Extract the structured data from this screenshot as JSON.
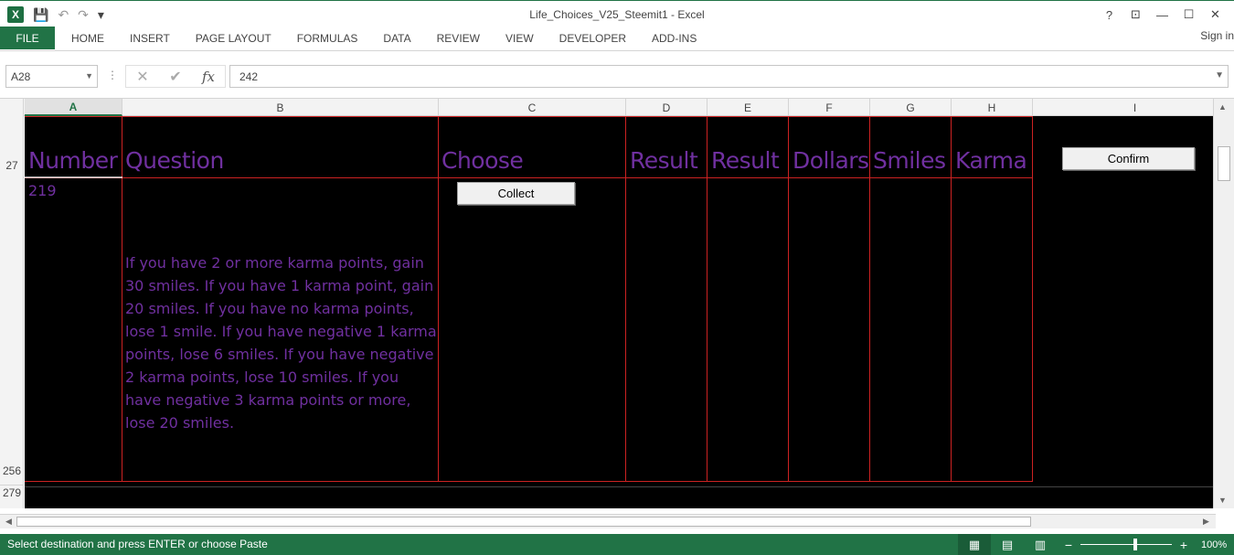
{
  "window": {
    "title": "Life_Choices_V25_Steemit1 - Excel",
    "help": "?",
    "controls": [
      "⊡",
      "—",
      "☐",
      "✕"
    ]
  },
  "qat": {
    "logo": "X",
    "save": "💾",
    "undo": "↶",
    "redo": "↷",
    "customize": "▾"
  },
  "ribbon": {
    "file": "FILE",
    "tabs": [
      "HOME",
      "INSERT",
      "PAGE LAYOUT",
      "FORMULAS",
      "DATA",
      "REVIEW",
      "VIEW",
      "DEVELOPER",
      "ADD-INS"
    ],
    "signin": "Sign in"
  },
  "formula_bar": {
    "name_box": "A28",
    "value": "242",
    "cancel": "✕",
    "enter": "✔",
    "fx": "fx"
  },
  "columns": [
    "A",
    "B",
    "C",
    "D",
    "E",
    "F",
    "G",
    "H",
    "I"
  ],
  "rows": [
    "27",
    "256",
    "279"
  ],
  "sheet": {
    "headers": [
      "Number",
      "Question",
      "Choose",
      "Result",
      "Result",
      "Dollars",
      "Smiles",
      "Karma"
    ],
    "number": "219",
    "question": "If you have 2 or more karma points, gain 30 smiles. If you have 1 karma point, gain 20 smiles. If you have no karma points, lose 1 smile. If you have negative 1 karma points, lose 6 smiles. If you have negative 2 karma points, lose 10 smiles. If you have negative 3 karma points or more, lose 20 smiles.",
    "collect_button": "Collect",
    "confirm_button": "Confirm"
  },
  "status": {
    "message": "Select destination and press ENTER or choose Paste",
    "zoom": "100%",
    "zoom_level": 100
  },
  "colors": {
    "accent": "#217346",
    "text_purple": "#7030a0",
    "grid_line": "#cc2222"
  }
}
